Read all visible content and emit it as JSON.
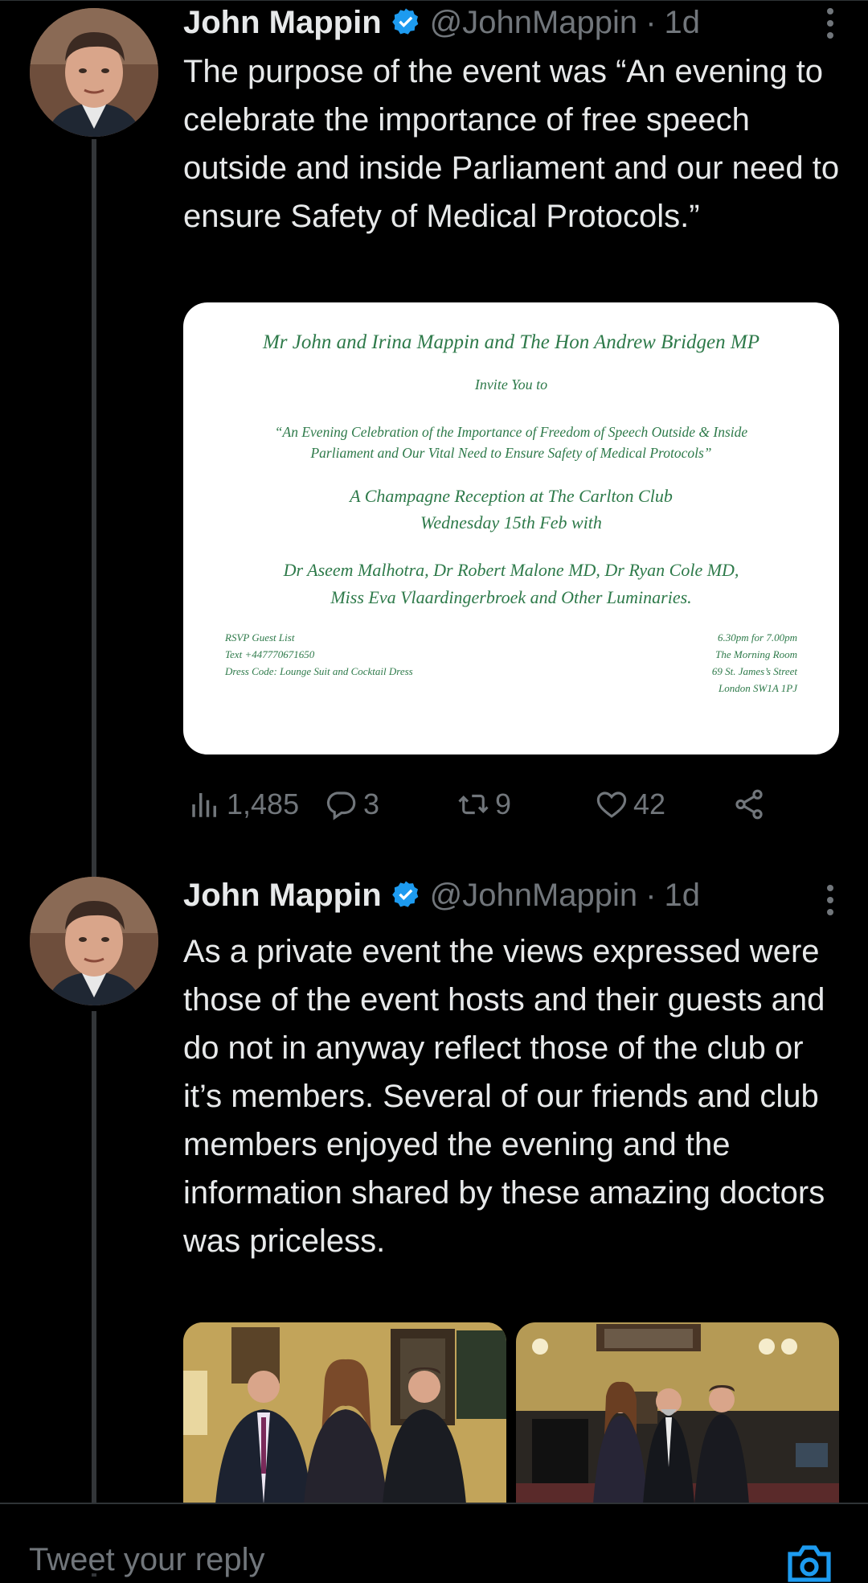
{
  "tweets": [
    {
      "name": "John Mappin",
      "handle": "@JohnMappin",
      "separator": "·",
      "time": "1d",
      "text": "The purpose of the event was “An evening to celebrate the importance of free speech outside and inside Parliament and our need to ensure Safety of Medical Protocols.”",
      "invitation": {
        "hosts": "Mr John and Irina Mappin and The Hon Andrew Bridgen MP",
        "invite": "Invite You to",
        "title_line1": "“An Evening Celebration of the Importance of Freedom of Speech Outside & Inside",
        "title_line2": "Parliament and Our Vital Need to Ensure Safety of Medical Protocols”",
        "venue_line1": "A Champagne Reception at The Carlton Club",
        "venue_line2": "Wednesday 15th Feb with",
        "guests_line1": "Dr Aseem Malhotra, Dr Robert Malone MD, Dr Ryan Cole MD,",
        "guests_line2": "Miss Eva Vlaardingerbroek and Other Luminaries.",
        "left_line1": "RSVP Guest List",
        "left_line2": "Text +447770671650",
        "left_line3": "Dress Code: Lounge Suit and Cocktail Dress",
        "right_line1": "6.30pm for 7.00pm",
        "right_line2": "The Morning Room",
        "right_line3": "69 St. James’s Street",
        "right_line4": "London SW1A 1PJ"
      },
      "stats": {
        "views": "1,485",
        "replies": "3",
        "retweets": "9",
        "likes": "42"
      }
    },
    {
      "name": "John Mappin",
      "handle": "@JohnMappin",
      "separator": "·",
      "time": "1d",
      "text": "As a private event the views expressed were those of the event hosts and their guests and do not in anyway reflect those of the club or it’s members. Several of our friends and club members enjoyed the evening and the information shared by these amazing doctors was priceless."
    }
  ],
  "reply_bar": {
    "placeholder": "Tweet your reply"
  },
  "colors": {
    "background": "#000000",
    "text": "#e7e9ea",
    "secondary": "#71767b",
    "verified": "#1d9bf0",
    "invitation_ink": "#2e7a4a"
  },
  "icons": [
    "verified-badge-icon",
    "more-icon",
    "views-icon",
    "reply-icon",
    "retweet-icon",
    "like-icon",
    "share-icon",
    "camera-icon"
  ]
}
